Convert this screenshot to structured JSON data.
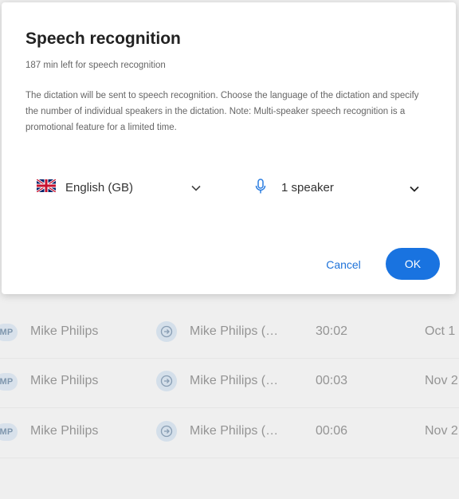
{
  "dialog": {
    "title": "Speech recognition",
    "minutes_left": "187 min left for speech recognition",
    "description": "The dictation will be sent to speech recognition. Choose the language of the dictation and specify the number of individual speakers in the dictation. Note: Multi-speaker speech recognition is a promotional feature for a limited time.",
    "language": {
      "selected": "English (GB)",
      "icon": "uk-flag-icon"
    },
    "speakers": {
      "selected": "1 speaker",
      "icon": "microphone-icon"
    },
    "cancel_label": "Cancel",
    "ok_label": "OK",
    "accent_color": "#1973e0"
  },
  "list": {
    "rows": [
      {
        "avatar": "MP",
        "author": "Mike Philips",
        "assignee": "Mike Philips (…",
        "duration": "30:02",
        "date": "Oct 1"
      },
      {
        "avatar": "MP",
        "author": "Mike Philips",
        "assignee": "Mike Philips (…",
        "duration": "00:03",
        "date": "Nov 2"
      },
      {
        "avatar": "MP",
        "author": "Mike Philips",
        "assignee": "Mike Philips (…",
        "duration": "00:06",
        "date": "Nov 2"
      }
    ]
  }
}
